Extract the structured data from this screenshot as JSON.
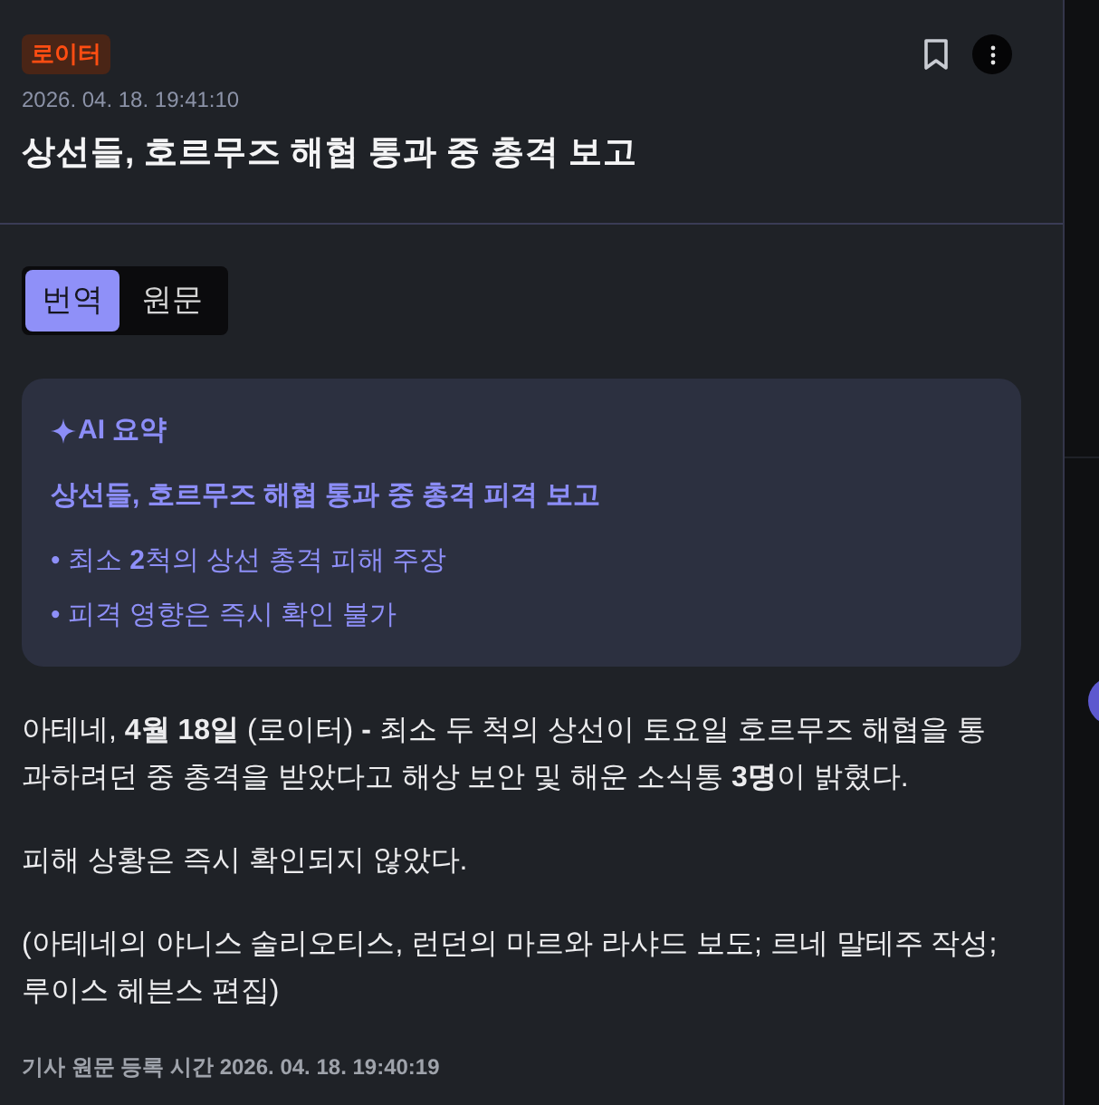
{
  "source_badge": "로이터",
  "timestamp": "2026. 04. 18. 19:41:10",
  "title": "상선들, 호르무즈 해협 통과 중 총격 보고",
  "bookmarked": false,
  "tabs": [
    {
      "label": "번역",
      "selected": true
    },
    {
      "label": "원문",
      "selected": false
    }
  ],
  "summary": {
    "heading": "AI 요약",
    "title": "상선들, 호르무즈 해협 통과 중 총격 피격 보고",
    "bullets": [
      "• 최소 **2**척의 상선 총격 피해 주장",
      "• 피격 영향은 즉시 확인 불가"
    ]
  },
  "body": [
    "아테네, **4월 18일** (로이터) **-** 최소 두 척의 상선이 토요일 호르무즈 해협을 통과하려던 중 총격을 받았다고 해상 보안 및 해운 소식통 **3명**이 밝혔다.",
    "피해 상황은 즉시 확인되지 않았다.",
    "(아테네의 야니스 술리오티스, 런던의 마르와 라샤드 보도; 르네 말테주 작성; 루이스 헤븐스 편집)"
  ],
  "footer": "기사 원문 등록 시간 2026. 04. 18. 19:40:19"
}
